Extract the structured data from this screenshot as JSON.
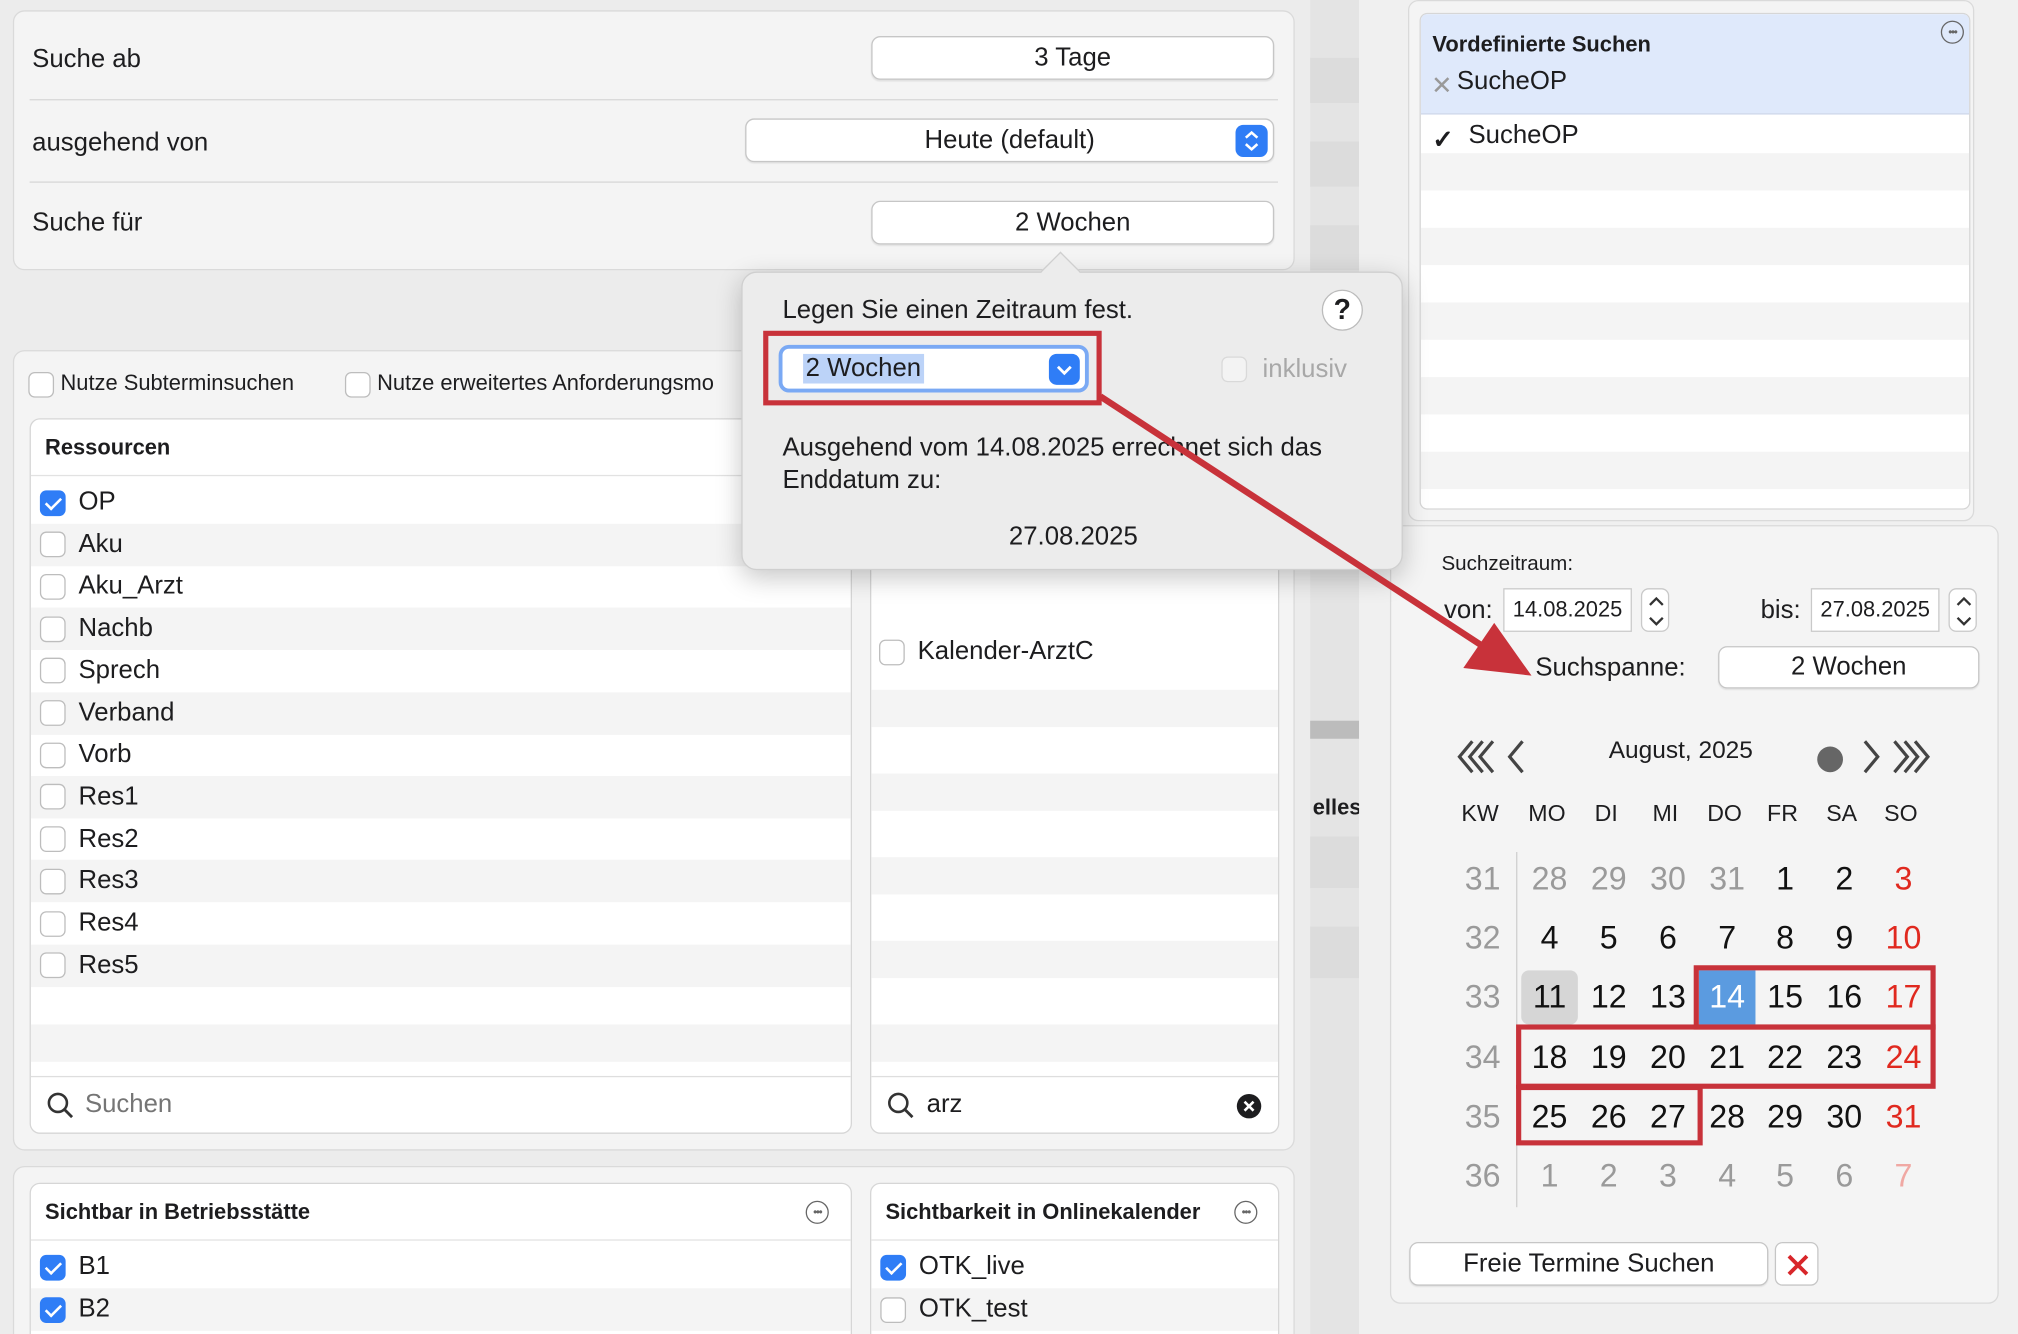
{
  "search": {
    "search_from_label": "Suche ab",
    "search_from_value": "3 Tage",
    "starting_from_label": "ausgehend von",
    "starting_from_value": "Heute (default)",
    "search_for_label": "Suche für",
    "search_for_value": "2 Wochen"
  },
  "options": {
    "subterm": "Nutze Subterminsuchen",
    "extended": "Nutze erweitertes Anforderungsmo"
  },
  "resources": {
    "header": "Ressourcen",
    "items": [
      {
        "label": "OP",
        "checked": true
      },
      {
        "label": "Aku",
        "checked": false
      },
      {
        "label": "Aku_Arzt",
        "checked": false
      },
      {
        "label": "Nachb",
        "checked": false
      },
      {
        "label": "Sprech",
        "checked": false
      },
      {
        "label": "Verband",
        "checked": false
      },
      {
        "label": "Vorb",
        "checked": false
      },
      {
        "label": "Res1",
        "checked": false
      },
      {
        "label": "Res2",
        "checked": false
      },
      {
        "label": "Res3",
        "checked": false
      },
      {
        "label": "Res4",
        "checked": false
      },
      {
        "label": "Res5",
        "checked": false
      }
    ],
    "search_placeholder": "Suchen"
  },
  "resources2": {
    "items": [
      {
        "label": "Kalender-ArztC",
        "checked": false
      }
    ],
    "search_value": "arz"
  },
  "partial_label": "elles",
  "visible_site": {
    "header": "Sichtbar in Betriebsstätte",
    "items": [
      {
        "label": "B1",
        "checked": true
      },
      {
        "label": "B2",
        "checked": true
      }
    ]
  },
  "online_calendar": {
    "header": "Sichtbarkeit in Onlinekalender",
    "items": [
      {
        "label": "OTK_live",
        "checked": true
      },
      {
        "label": "OTK_test",
        "checked": false
      }
    ]
  },
  "popover": {
    "title": "Legen Sie einen Zeitraum fest.",
    "help": "?",
    "select_value": "2 Wochen",
    "inclusive_label": "inklusiv",
    "description": "Ausgehend vom 14.08.2025 errechnet sich das Enddatum zu:",
    "end_date": "27.08.2025"
  },
  "predefined": {
    "header": "Vordefinierte Suchen",
    "chip": "SucheOP",
    "item": "SucheOP"
  },
  "range": {
    "label": "Suchzeitraum:",
    "from_label": "von:",
    "from_value": "14.08.2025",
    "to_label": "bis:",
    "to_value": "27.08.2025",
    "span_label": "Suchspanne:",
    "span_value": "2 Wochen"
  },
  "calendar": {
    "month": "August, 2025",
    "headers": [
      "KW",
      "MO",
      "DI",
      "MI",
      "DO",
      "FR",
      "SA",
      "SO"
    ],
    "weeks": [
      {
        "kw": "31",
        "days": [
          "28",
          "29",
          "30",
          "31",
          "1",
          "2",
          "3"
        ]
      },
      {
        "kw": "32",
        "days": [
          "4",
          "5",
          "6",
          "7",
          "8",
          "9",
          "10"
        ]
      },
      {
        "kw": "33",
        "days": [
          "11",
          "12",
          "13",
          "14",
          "15",
          "16",
          "17"
        ]
      },
      {
        "kw": "34",
        "days": [
          "18",
          "19",
          "20",
          "21",
          "22",
          "23",
          "24"
        ]
      },
      {
        "kw": "35",
        "days": [
          "25",
          "26",
          "27",
          "28",
          "29",
          "30",
          "31"
        ]
      },
      {
        "kw": "36",
        "days": [
          "1",
          "2",
          "3",
          "4",
          "5",
          "6",
          "7"
        ]
      }
    ]
  },
  "actions": {
    "search_button": "Freie Termine Suchen"
  },
  "colors": {
    "accent": "#2f7df6",
    "selected_day": "#5b9be0",
    "highlight": "#c8323a",
    "sunday": "#e0291f"
  }
}
